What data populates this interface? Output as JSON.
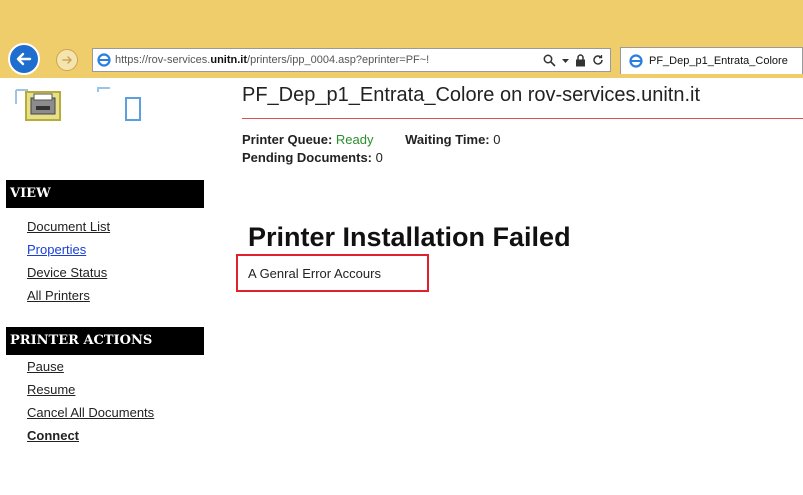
{
  "browser": {
    "url_prefix": "https://rov-services.",
    "url_domain": "unitn.it",
    "url_suffix": "/printers/ipp_0004.asp?eprinter=PF~!",
    "tab_title": "PF_Dep_p1_Entrata_Colore"
  },
  "header": {
    "title": "PF_Dep_p1_Entrata_Colore on rov-services.unitn.it"
  },
  "status": {
    "queue_label": "Printer Queue:",
    "queue_value": "Ready",
    "wait_label": "Waiting Time:",
    "wait_value": "0",
    "pending_label": "Pending Documents:",
    "pending_value": "0"
  },
  "sidebar": {
    "view_heading": "VIEW",
    "view_items": [
      {
        "label": "Document List"
      },
      {
        "label": "Properties"
      },
      {
        "label": "Device Status"
      },
      {
        "label": "All Printers"
      }
    ],
    "actions_heading": "PRINTER ACTIONS",
    "action_items": [
      {
        "label": "Pause"
      },
      {
        "label": "Resume"
      },
      {
        "label": "Cancel All Documents"
      },
      {
        "label": "Connect"
      }
    ]
  },
  "main": {
    "heading": "Printer Installation Failed",
    "error_message": "A Genral Error Accours"
  },
  "colors": {
    "chrome": "#f0cd6b",
    "ready": "#2a8f2a",
    "link_active": "#1a3fd6",
    "error_border": "#e0202a"
  }
}
